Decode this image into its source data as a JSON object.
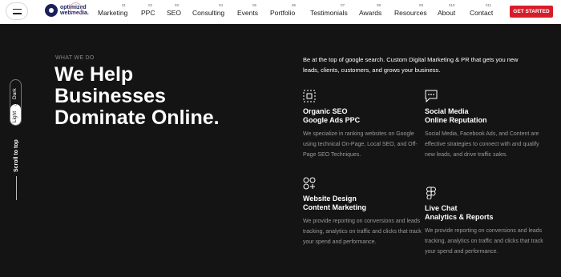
{
  "header": {
    "logo_text": "optimized webmedia.",
    "nav": [
      {
        "label": "Marketing",
        "num": "01"
      },
      {
        "label": "PPC",
        "num": "02"
      },
      {
        "label": "SEO",
        "num": "03"
      },
      {
        "label": "Consulting",
        "num": "04"
      },
      {
        "label": "Events",
        "num": "05"
      },
      {
        "label": "Portfolio",
        "num": "06"
      },
      {
        "label": "Testimonials",
        "num": "07"
      },
      {
        "label": "Awards",
        "num": "08"
      },
      {
        "label": "Resources",
        "num": "09"
      },
      {
        "label": "About",
        "num": "010"
      },
      {
        "label": "Contact",
        "num": "011"
      }
    ],
    "cta_label": "GET STARTED"
  },
  "side": {
    "dark_label": "Dark",
    "light_label": "Light",
    "scroll_label": "Scroll to top"
  },
  "hero": {
    "eyebrow": "WHAT WE DO",
    "headline": "We Help Businesses Dominate Online.",
    "intro": "Be at the top of google search. Custom Digital Marketing & PR that gets you new leads, clients, customers, and grows your business."
  },
  "services": [
    {
      "icon": "frame-select-icon",
      "title_line1": "Organic SEO",
      "title_line2": "Google Ads PPC",
      "desc": "We specialize in ranking websites on Google using technical On-Page, Local SEO, and Off-Page SEO Techniques."
    },
    {
      "icon": "chat-bubble-icon",
      "title_line1": "Social Media",
      "title_line2": "Online Reputation",
      "desc": "Social Media, Facebook Ads, and Content are effective strategies to connect with and qualify new leads, and drive traffic sales."
    },
    {
      "icon": "shapes-icon",
      "title_line1": "Website Design",
      "title_line2": "Content Marketing",
      "desc": "We provide reporting on conversions and leads tracking, analytics on traffic and clicks that track your spend and performance."
    },
    {
      "icon": "figma-icon",
      "title_line1": "Live Chat",
      "title_line2": "Analytics & Reports",
      "desc": "We provide reporting on conversions and leads tracking, analytics on traffic and clicks that track your spend and performance."
    }
  ],
  "colors": {
    "accent": "#d81b2a",
    "background": "#141414",
    "logo": "#1b1f5a"
  }
}
